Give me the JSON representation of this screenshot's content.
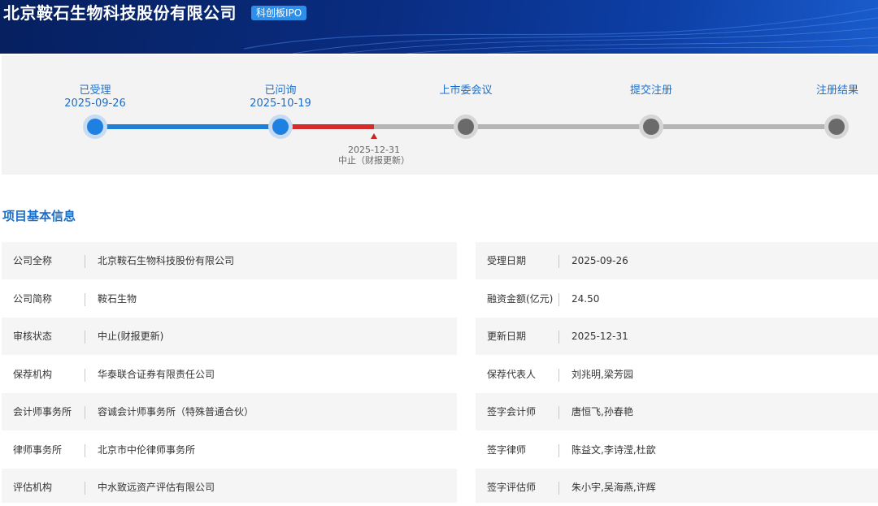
{
  "header": {
    "company_name": "北京鞍石生物科技股份有限公司",
    "board_badge": "科创板IPO"
  },
  "progress": {
    "steps": [
      {
        "label": "已受理",
        "date": "2025-09-26",
        "active": true
      },
      {
        "label": "已问询",
        "date": "2025-10-19",
        "active": true
      },
      {
        "label": "上市委会议",
        "date": "",
        "active": false
      },
      {
        "label": "提交注册",
        "date": "",
        "active": false
      },
      {
        "label": "注册结果",
        "date": "",
        "active": false
      }
    ],
    "current_marker": {
      "date": "2025-12-31",
      "status": "中止（财报更新）"
    },
    "colors": {
      "completed": "#1e7fd6",
      "halted": "#d42a2a",
      "pending": "#b5b5b5"
    }
  },
  "basic_info": {
    "title": "项目基本信息",
    "left": [
      {
        "label": "公司全称",
        "value": "北京鞍石生物科技股份有限公司"
      },
      {
        "label": "公司简称",
        "value": "鞍石生物"
      },
      {
        "label": "审核状态",
        "value": "中止(财报更新)"
      },
      {
        "label": "保荐机构",
        "value": "华泰联合证券有限责任公司"
      },
      {
        "label": "会计师事务所",
        "value": "容诚会计师事务所（特殊普通合伙）"
      },
      {
        "label": "律师事务所",
        "value": "北京市中伦律师事务所"
      },
      {
        "label": "评估机构",
        "value": "中水致远资产评估有限公司"
      }
    ],
    "right": [
      {
        "label": "受理日期",
        "value": "2025-09-26"
      },
      {
        "label": "融资金额(亿元)",
        "value": "24.50"
      },
      {
        "label": "更新日期",
        "value": "2025-12-31"
      },
      {
        "label": "保荐代表人",
        "value": "刘兆明,梁芳园"
      },
      {
        "label": "签字会计师",
        "value": "唐恒飞,孙春艳"
      },
      {
        "label": "签字律师",
        "value": "陈益文,李诗滢,杜歆"
      },
      {
        "label": "签字评估师",
        "value": "朱小宇,吴海燕,许辉"
      }
    ]
  }
}
